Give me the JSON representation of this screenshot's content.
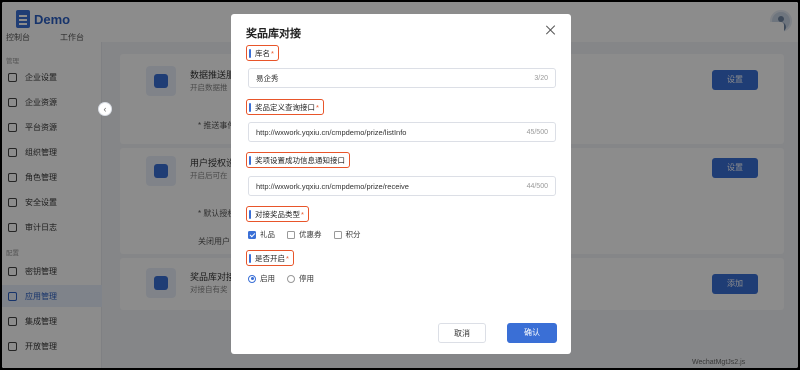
{
  "app": {
    "logo_text": "Demo"
  },
  "header": {
    "tabs": [
      "控制台",
      "工作台"
    ]
  },
  "sidebar": {
    "group_manage": "管理",
    "group_config": "配置",
    "items": [
      {
        "label": "企业设置",
        "icon": "building-icon"
      },
      {
        "label": "企业资源",
        "icon": "folder-icon"
      },
      {
        "label": "平台资源",
        "icon": "inbox-icon"
      },
      {
        "label": "组织管理",
        "icon": "users-icon"
      },
      {
        "label": "角色管理",
        "icon": "role-icon"
      },
      {
        "label": "安全设置",
        "icon": "shield-icon"
      },
      {
        "label": "审计日志",
        "icon": "log-icon"
      },
      {
        "label": "密钥管理",
        "icon": "key-icon"
      },
      {
        "label": "应用管理",
        "icon": "apps-icon"
      },
      {
        "label": "集成管理",
        "icon": "layers-icon"
      },
      {
        "label": "开放管理",
        "icon": "calendar-icon"
      }
    ]
  },
  "background": {
    "services": [
      {
        "title": "数据推送服",
        "desc": "开启数据推",
        "button": "设置",
        "row": "* 推送事件"
      },
      {
        "title": "用户授权设",
        "desc": "开启后可在",
        "button": "设置",
        "row": "* 默认授权",
        "row2": "关闭用户"
      },
      {
        "title": "奖品库对接",
        "desc": "对接自有奖",
        "button": "添加"
      }
    ],
    "footer_text": "WechatMgtJs2.js"
  },
  "modal": {
    "title": "奖品库对接",
    "fields": {
      "name": {
        "label": "库名",
        "value": "易企秀",
        "counter": "3/20"
      },
      "query_api": {
        "label": "奖品定义查询接口",
        "value": "http://wxwork.yqxiu.cn/cmpdemo/prize/listInfo",
        "counter": "45/500"
      },
      "notify_api": {
        "label": "奖项设置成功信息通知接口",
        "value": "http://wxwork.yqxiu.cn/cmpdemo/prize/receive",
        "counter": "44/500"
      },
      "prize_type": {
        "label": "对接奖品类型",
        "options": [
          {
            "label": "礼品",
            "checked": true
          },
          {
            "label": "优惠券",
            "checked": false
          },
          {
            "label": "积分",
            "checked": false
          }
        ]
      },
      "enabled": {
        "label": "是否开启",
        "options": [
          {
            "label": "启用",
            "selected": true
          },
          {
            "label": "停用",
            "selected": false
          }
        ]
      }
    },
    "required_mark": "*",
    "cancel_label": "取消",
    "ok_label": "确认"
  }
}
